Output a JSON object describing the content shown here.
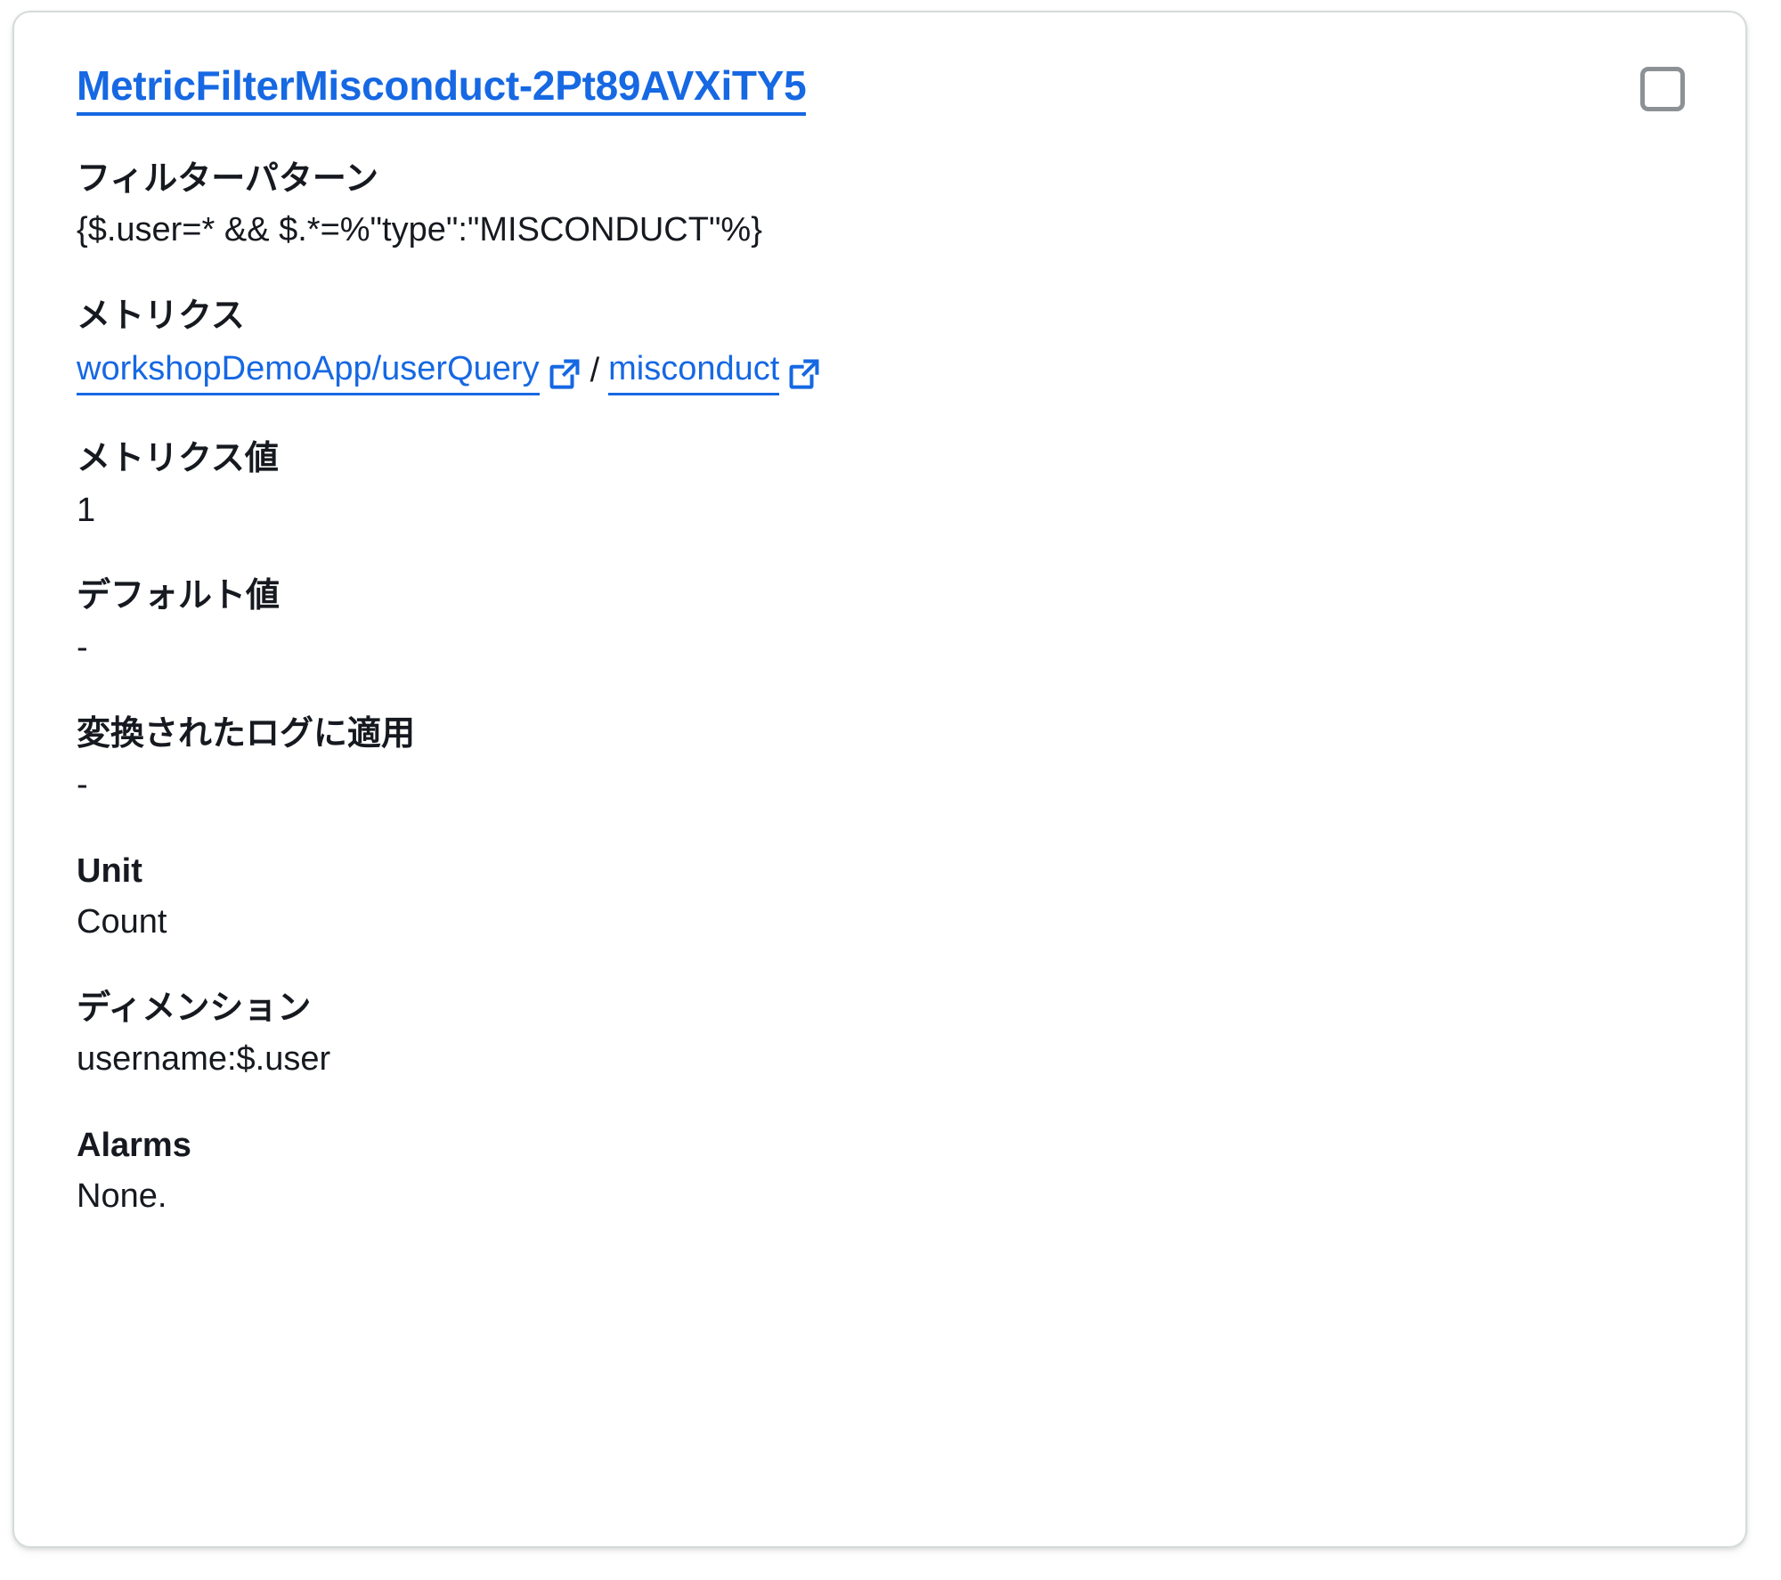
{
  "card": {
    "title": "MetricFilterMisconduct-2Pt89AVXiTY5",
    "select_checkbox_label": "",
    "accent_color": "#1668e3",
    "text_color": "#16191f",
    "border_color": "#d5dbdb",
    "checkbox_border_color": "#8c9196"
  },
  "fields": {
    "filter_pattern": {
      "label": "フィルターパターン",
      "value": "{$.user=* && $.*=%\"type\":\"MISCONDUCT\"%}"
    },
    "metrics": {
      "label": "メトリクス",
      "namespace_link": "workshopDemoApp/userQuery",
      "separator": "/",
      "metric_link": "misconduct",
      "external_icon_name": "external-link-icon"
    },
    "metric_value": {
      "label": "メトリクス値",
      "value": "1"
    },
    "default_value": {
      "label": "デフォルト値",
      "value": "-"
    },
    "apply_to_transformed_logs": {
      "label": "変換されたログに適用",
      "value": "-"
    },
    "unit": {
      "label": "Unit",
      "value": "Count"
    },
    "dimensions": {
      "label": "ディメンション",
      "value": "username:$.user"
    },
    "alarms": {
      "label": "Alarms",
      "value": "None."
    }
  }
}
